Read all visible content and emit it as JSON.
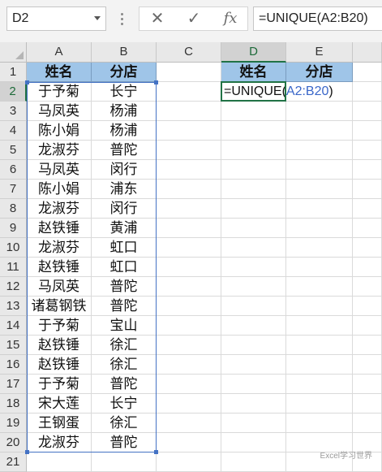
{
  "formula_bar": {
    "name_box": "D2",
    "cancel_icon": "✕",
    "enter_icon": "✓",
    "fx_icon": "fx",
    "formula": "=UNIQUE(A2:B20)"
  },
  "columns": [
    "A",
    "B",
    "C",
    "D",
    "E"
  ],
  "rows": [
    "1",
    "2",
    "3",
    "4",
    "5",
    "6",
    "7",
    "8",
    "9",
    "10",
    "11",
    "12",
    "13",
    "14",
    "15",
    "16",
    "17",
    "18",
    "19",
    "20",
    "21"
  ],
  "header_row": {
    "a": "姓名",
    "b": "分店",
    "d": "姓名",
    "e": "分店"
  },
  "data": [
    [
      "于予菊",
      "长宁"
    ],
    [
      "马凤英",
      "杨浦"
    ],
    [
      "陈小娟",
      "杨浦"
    ],
    [
      "龙淑芬",
      "普陀"
    ],
    [
      "马凤英",
      "闵行"
    ],
    [
      "陈小娟",
      "浦东"
    ],
    [
      "龙淑芬",
      "闵行"
    ],
    [
      "赵铁锤",
      "黄浦"
    ],
    [
      "龙淑芬",
      "虹口"
    ],
    [
      "赵铁锤",
      "虹口"
    ],
    [
      "马凤英",
      "普陀"
    ],
    [
      "诸葛钢铁",
      "普陀"
    ],
    [
      "于予菊",
      "宝山"
    ],
    [
      "赵铁锤",
      "徐汇"
    ],
    [
      "赵铁锤",
      "徐汇"
    ],
    [
      "于予菊",
      "普陀"
    ],
    [
      "宋大莲",
      "长宁"
    ],
    [
      "王钢蛋",
      "徐汇"
    ],
    [
      "龙淑芬",
      "普陀"
    ]
  ],
  "editing_cell": {
    "prefix": "=UNIQUE(",
    "ref": "A2:B20",
    "suffix": ")"
  },
  "watermark": "Excel学习世界",
  "colors": {
    "header_fill": "#9fc5e8",
    "selection_green": "#217346",
    "range_blue": "#4472c4"
  }
}
